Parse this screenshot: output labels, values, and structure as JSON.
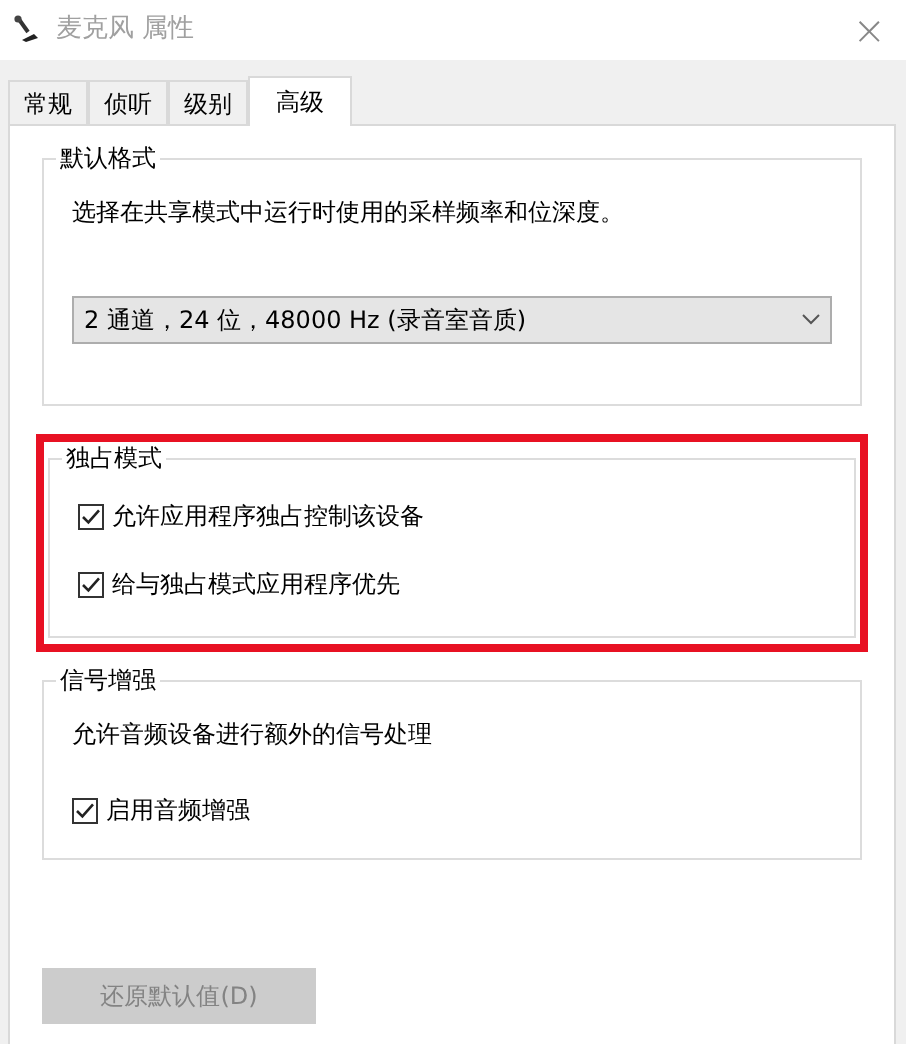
{
  "window": {
    "title": "麦克风 属性",
    "close": "×"
  },
  "tabs": [
    {
      "label": "常规",
      "selected": false
    },
    {
      "label": "侦听",
      "selected": false
    },
    {
      "label": "级别",
      "selected": false
    },
    {
      "label": "高级",
      "selected": true
    }
  ],
  "groups": [
    {
      "title": "默认格式",
      "highlighted": false,
      "items": [
        {
          "kind": "text",
          "text": "选择在共享模式中运行时使用的采样频率和位深度。"
        },
        {
          "kind": "dropdown",
          "value": "2 通道，24 位，48000 Hz (录音室音质)"
        }
      ]
    },
    {
      "title": "独占模式",
      "highlighted": true,
      "items": [
        {
          "kind": "checkbox",
          "label": "允许应用程序独占控制该设备",
          "checked": true
        },
        {
          "kind": "checkbox",
          "label": "给与独占模式应用程序优先",
          "checked": true
        }
      ]
    },
    {
      "title": "信号增强",
      "highlighted": false,
      "items": [
        {
          "kind": "text",
          "text": "允许音频设备进行额外的信号处理"
        },
        {
          "kind": "checkbox",
          "label": "启用音频增强",
          "checked": true
        }
      ]
    }
  ],
  "restore_button": {
    "label": "还原默认值(D)",
    "disabled": true
  }
}
